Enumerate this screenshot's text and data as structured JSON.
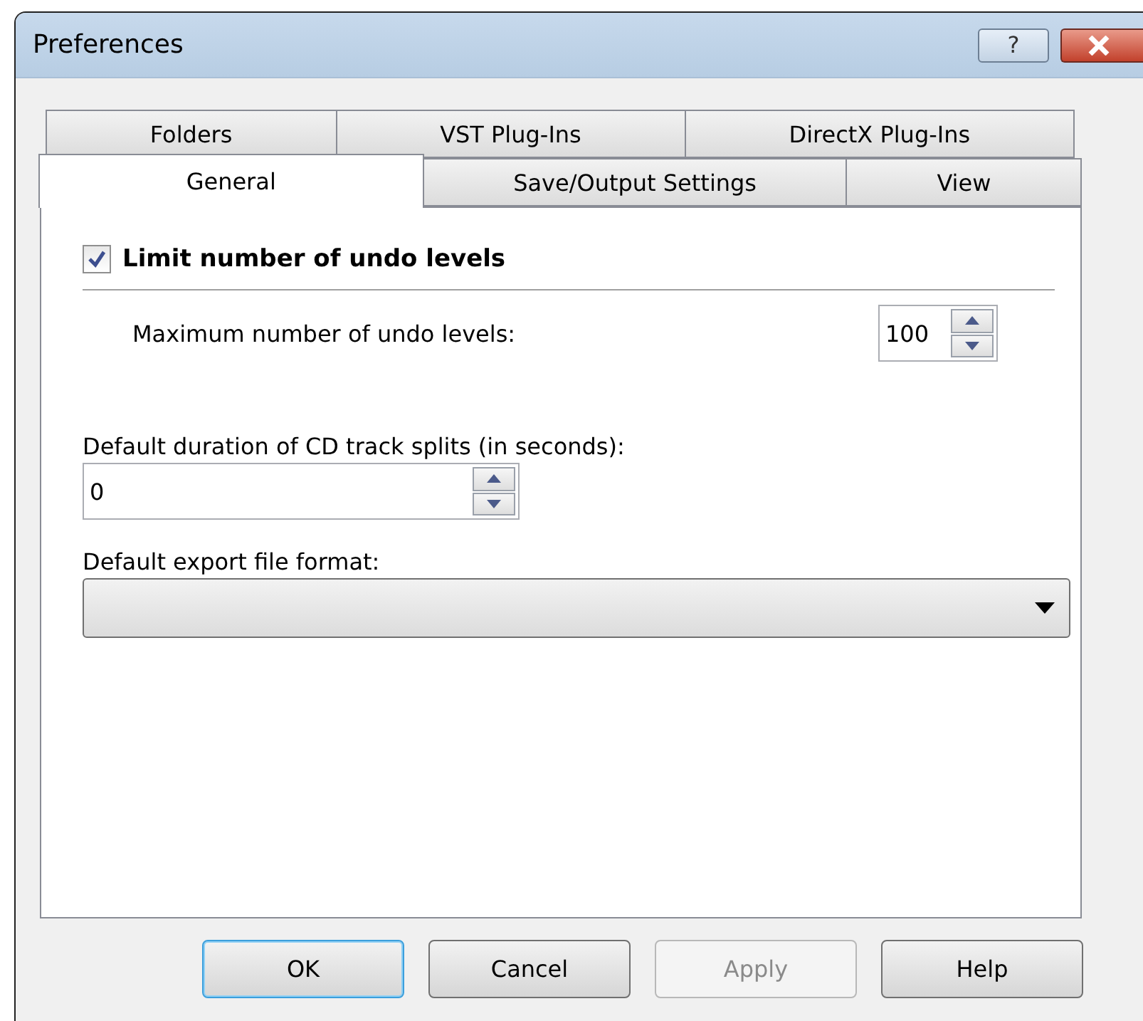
{
  "window": {
    "title": "Preferences",
    "help_button": "?"
  },
  "tab_rows": [
    [
      {
        "label": "Folders",
        "selected": false
      },
      {
        "label": "VST Plug-Ins",
        "selected": false
      },
      {
        "label": "DirectX Plug-Ins",
        "selected": false
      }
    ],
    [
      {
        "label": "General",
        "selected": true
      },
      {
        "label": "Save/Output Settings",
        "selected": false
      },
      {
        "label": "View",
        "selected": false
      }
    ]
  ],
  "limit_undo": {
    "label": "Limit number of undo levels",
    "checked": true
  },
  "max_undo": {
    "label": "Maximum number of undo levels:",
    "value": "100"
  },
  "cd_split": {
    "label": "Default duration of CD track splits (in seconds):",
    "value": "0"
  },
  "export_format": {
    "label": "Default export file format:"
  },
  "buttons": [
    {
      "label": "OK",
      "default": true,
      "disabled": false
    },
    {
      "label": "Cancel",
      "default": false,
      "disabled": false
    },
    {
      "label": "Apply",
      "default": false,
      "disabled": true
    },
    {
      "label": "Help",
      "default": false,
      "disabled": false
    }
  ]
}
